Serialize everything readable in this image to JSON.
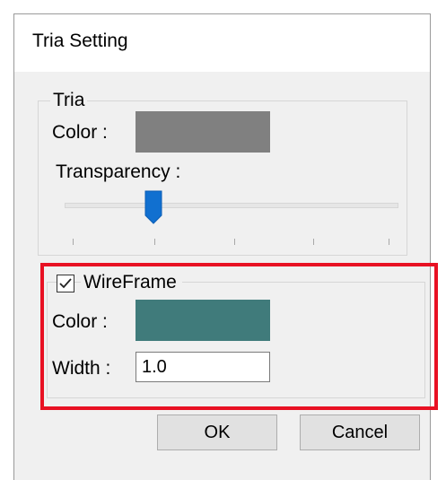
{
  "window": {
    "title": "Tria Setting"
  },
  "tria_group": {
    "legend": "Tria",
    "color_label": "Color :",
    "color_value": "#808080",
    "transparency_label": "Transparency :",
    "transparency_slider_fraction": 0.25
  },
  "wireframe_group": {
    "checkbox_label": "WireFrame",
    "checked": true,
    "color_label": "Color :",
    "color_value": "#407b7b",
    "width_label": "Width :",
    "width_value": "1.0"
  },
  "buttons": {
    "ok_label": "OK",
    "cancel_label": "Cancel"
  },
  "accent_colors": {
    "slider_thumb": "#1170d0",
    "highlight_border": "#e81123"
  }
}
